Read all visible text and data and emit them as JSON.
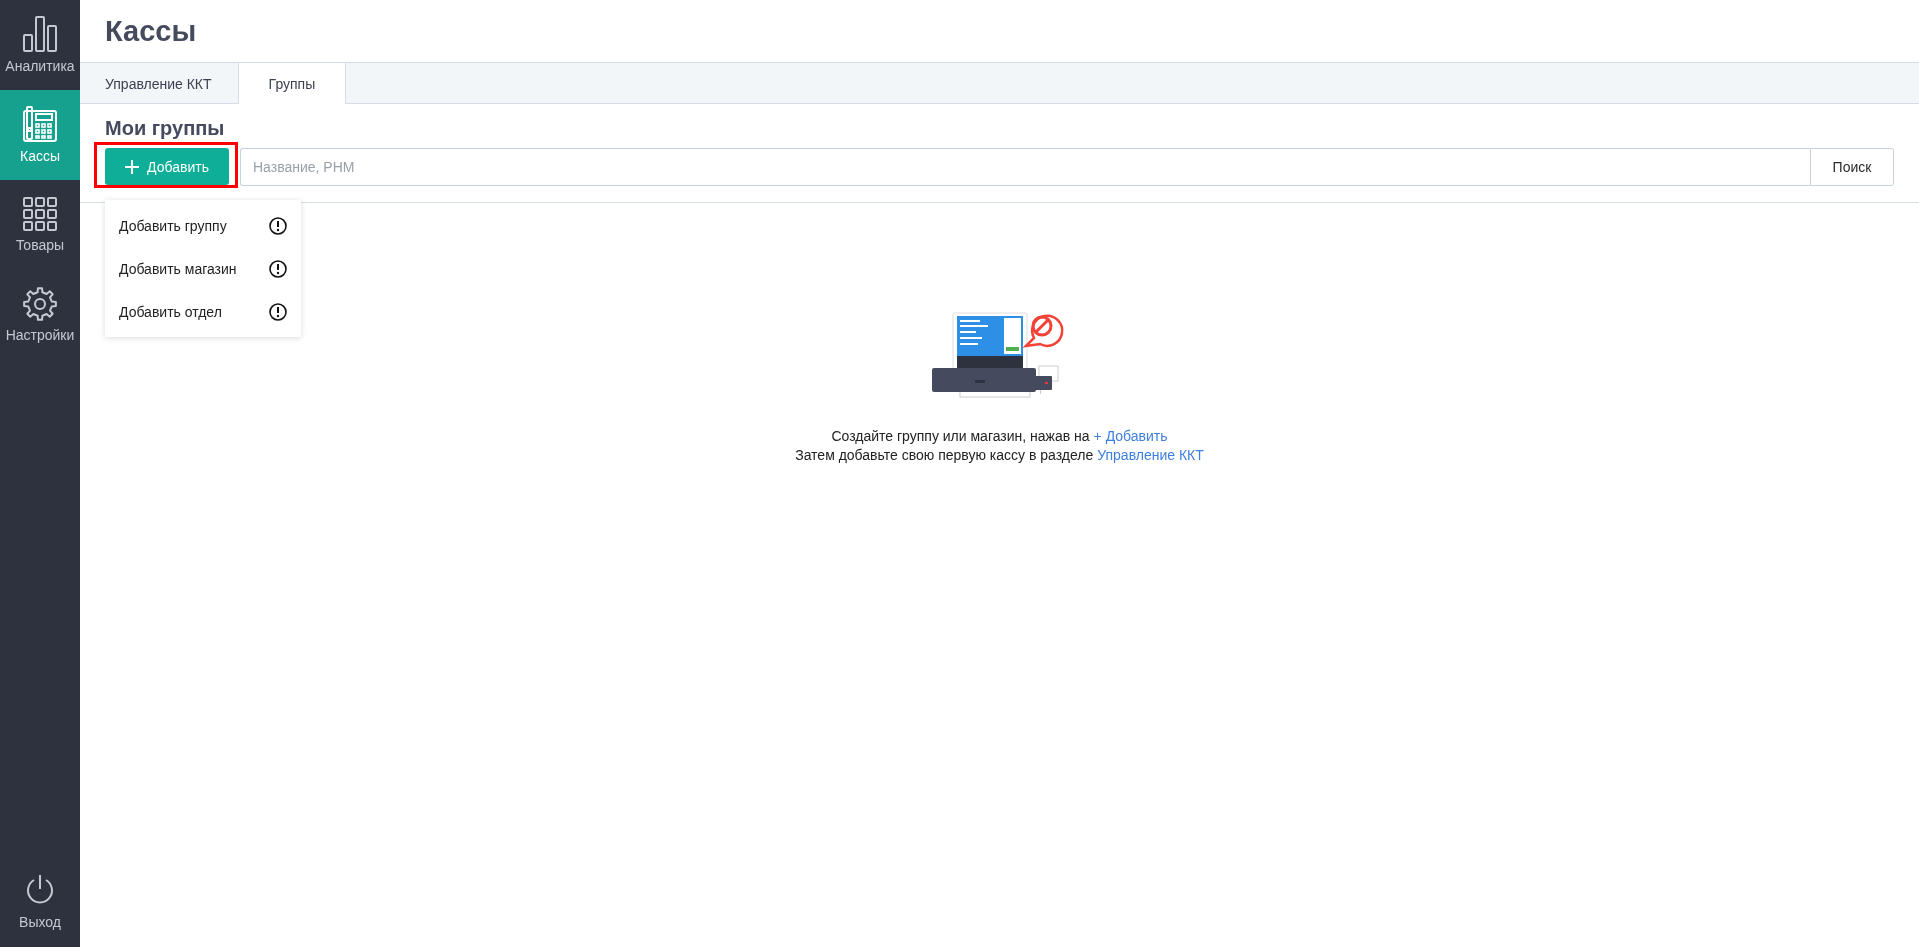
{
  "sidebar": {
    "items": [
      {
        "kind": "analytics",
        "label": "Аналитика",
        "selected": false
      },
      {
        "kind": "registers",
        "label": "Кассы",
        "selected": true
      },
      {
        "kind": "products",
        "label": "Товары",
        "selected": false
      },
      {
        "kind": "settings",
        "label": "Настройки",
        "selected": false
      }
    ],
    "logout": {
      "label": "Выход"
    }
  },
  "page": {
    "title": "Кассы"
  },
  "tabs": [
    {
      "label": "Управление ККТ",
      "selected": false
    },
    {
      "label": "Группы",
      "selected": true
    }
  ],
  "section_title": "Мои группы",
  "add_button": {
    "label": "Добавить",
    "highlighted": true
  },
  "add_menu": {
    "open": true,
    "items": [
      {
        "label": "Добавить группу"
      },
      {
        "label": "Добавить магазин"
      },
      {
        "label": "Добавить отдел"
      }
    ]
  },
  "search": {
    "placeholder": "Название, РНМ",
    "button": "Поиск"
  },
  "empty_state": {
    "lines": [
      {
        "text": "Создайте группу или магазин, нажав на",
        "link": "+ Добавить"
      },
      {
        "text": "Затем добавьте свою первую кассу в разделе",
        "link": "Управление ККТ"
      }
    ]
  }
}
